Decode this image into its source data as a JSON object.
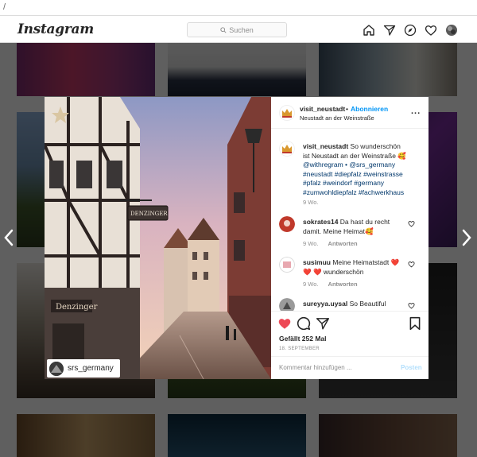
{
  "browser": {
    "path": "/"
  },
  "header": {
    "logo": "Instagram",
    "search_placeholder": "Suchen",
    "icons": [
      "home-icon",
      "direct-icon",
      "explore-icon",
      "heart-icon",
      "profile-icon"
    ]
  },
  "post": {
    "author": "visit_neustadt",
    "follow_separator": "•",
    "follow_label": "Abonnieren",
    "location": "Neustadt an der Weinstraße",
    "more_label": "...",
    "photo_tag": "srs_germany",
    "shop_sign": "DENZINGER",
    "shop_sign_lower": "Denzinger",
    "caption": {
      "user": "visit_neustadt",
      "text_1": "So wunderschön ist Neustadt an der Weinstraße 🥰",
      "text_2": "@withregram • @srs_germany",
      "hashtags": "#neustadt #diepfalz #weinstrasse #pfalz #weindorf #germany #zumwohldiepfalz #fachwerkhaus",
      "time": "9 Wo."
    },
    "comments": [
      {
        "user": "sokrates14",
        "text": "Da hast du recht damit. Meine Heimat🥰",
        "time": "9 Wo.",
        "reply": "Antworten"
      },
      {
        "user": "susimuu",
        "text": "Meine Heimatstadt ❤️ ❤️ ❤️ wunderschön",
        "time": "9 Wo.",
        "reply": "Antworten"
      },
      {
        "user": "sureyya.uysal",
        "text": "So Beautiful",
        "time": "",
        "reply": ""
      }
    ],
    "likes": "Gefällt 252 Mal",
    "date": "18. SEPTEMBER",
    "comment_placeholder": "Kommentar hinzufügen ...",
    "post_label": "Posten"
  },
  "colors": {
    "accent": "#0095f6",
    "liked": "#ed4956",
    "overlay": "#000000"
  }
}
